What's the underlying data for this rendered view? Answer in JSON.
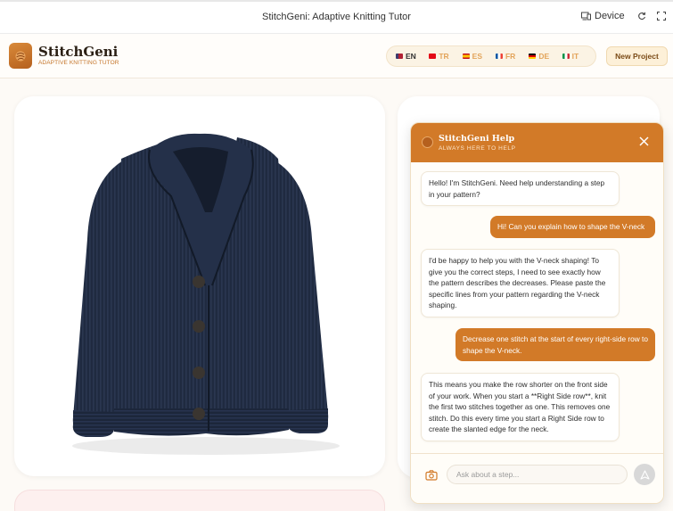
{
  "window": {
    "title": "StitchGeni: Adaptive Knitting Tutor",
    "device_label": "Device"
  },
  "header": {
    "brand": "StitchGeni",
    "tagline": "ADAPTIVE KNITTING TUTOR",
    "languages": [
      {
        "code": "EN",
        "flag_colors": [
          "#b22234",
          "#3c3b6e"
        ],
        "active": true
      },
      {
        "code": "TR",
        "flag_colors": [
          "#e30a17",
          "#e30a17"
        ],
        "active": false
      },
      {
        "code": "ES",
        "flag_colors": [
          "#c60b1e",
          "#ffc400"
        ],
        "active": false
      },
      {
        "code": "FR",
        "flag_colors": [
          "#0055a4",
          "#ef4135"
        ],
        "active": false
      },
      {
        "code": "DE",
        "flag_colors": [
          "#000000",
          "#dd0000"
        ],
        "active": false
      },
      {
        "code": "IT",
        "flag_colors": [
          "#009246",
          "#ce2b37"
        ],
        "active": false
      }
    ],
    "new_project_label": "New Project"
  },
  "chat": {
    "title": "StitchGeni Help",
    "subtitle": "ALWAYS HERE TO HELP",
    "messages": [
      {
        "role": "bot",
        "text": "Hello! I'm StitchGeni. Need help understanding a step in your pattern?"
      },
      {
        "role": "user",
        "text": "Hi! Can you explain how to shape the V-neck"
      },
      {
        "role": "bot",
        "text": "I'd be happy to help you with the V-neck shaping! To give you the correct steps, I need to see exactly how the pattern describes the decreases. Please paste the specific lines from your pattern regarding the V-neck shaping."
      },
      {
        "role": "user",
        "text": "Decrease one stitch at the start of every right-side row to shape the V-neck."
      },
      {
        "role": "bot",
        "text": "This means you make the row shorter on the front side of your work. When you start a **Right Side row**, knit the first two stitches together as one. This removes one stitch. Do this every time you start a Right Side row to create the slanted edge for the neck."
      }
    ],
    "input_placeholder": "Ask about a step..."
  },
  "colors": {
    "accent": "#d27a28",
    "accent_light": "#fdf0d8",
    "sweater": "#1f2a40"
  }
}
